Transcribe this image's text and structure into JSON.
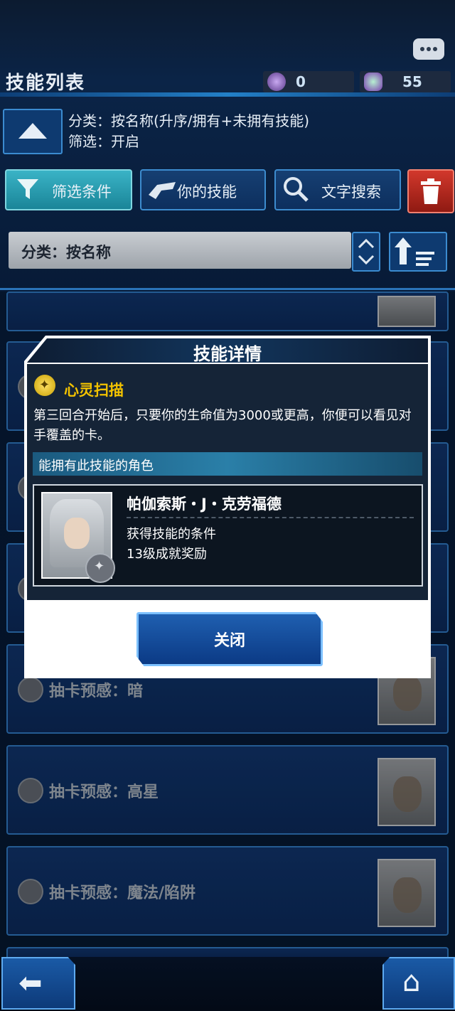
{
  "header": {
    "title": "技能列表",
    "currency_orbs": "0",
    "currency_gems": "55"
  },
  "sort_info": {
    "line1": "分类：按名称(升序/拥有+未拥有技能)",
    "line2": "筛选：开启"
  },
  "toolbar": {
    "filter_label": "筛选条件",
    "your_skills_label": "你的技能",
    "text_search_label": "文字搜索"
  },
  "sort_select": {
    "value": "分类：按名称"
  },
  "background_list": [
    {
      "name": "抽卡预感：暗"
    },
    {
      "name": "抽卡预感：高星"
    },
    {
      "name": "抽卡预感：魔法/陷阱"
    }
  ],
  "modal": {
    "title": "技能详情",
    "skill_name": "心灵扫描",
    "skill_description": "第三回合开始后，只要你的生命值为3000或更高，你便可以看见对手覆盖的卡。",
    "section_title": "能拥有此技能的角色",
    "character_name": "帕伽索斯・J・克劳福德",
    "condition_title": "获得技能的条件",
    "condition_value": "13级成就奖励",
    "close_label": "关闭"
  },
  "icons": {
    "back": "back-arrow-icon",
    "home": "home-icon"
  }
}
